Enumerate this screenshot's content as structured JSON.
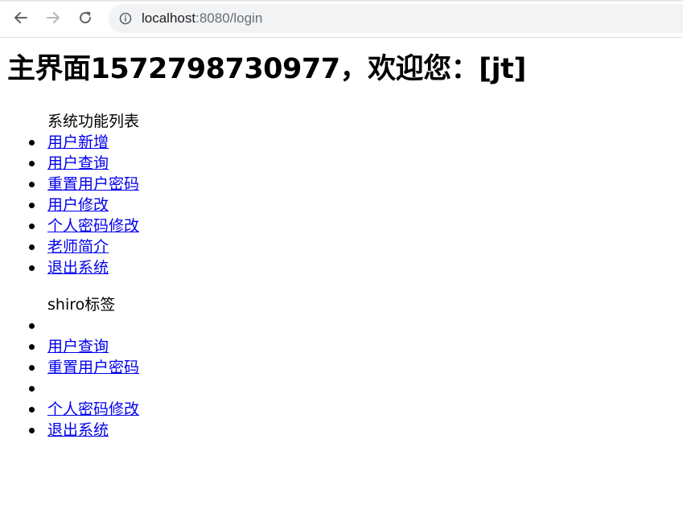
{
  "browser": {
    "url_host": "localhost",
    "url_rest": ":8080/login"
  },
  "page": {
    "title": "主界面1572798730977，欢迎您：[jt]",
    "system_menu": {
      "header": "系统功能列表",
      "items": [
        "用户新增",
        "用户查询",
        "重置用户密码",
        "用户修改",
        "个人密码修改",
        "老师简介",
        "退出系统"
      ]
    },
    "shiro_menu": {
      "header": "shiro标签",
      "items": [
        "",
        "用户查询",
        "重置用户密码",
        "",
        "个人密码修改",
        "退出系统"
      ]
    }
  }
}
